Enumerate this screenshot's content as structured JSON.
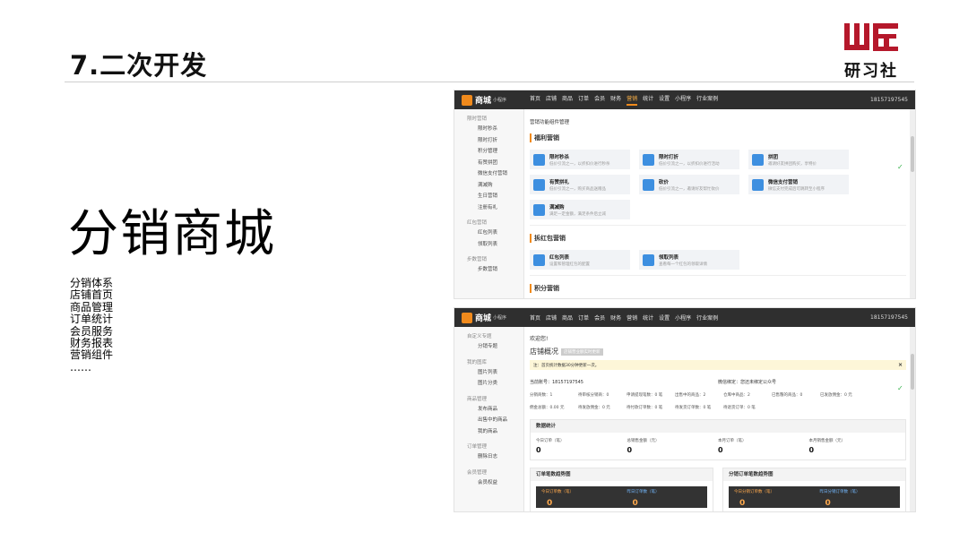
{
  "slide": {
    "title": "7.二次开发",
    "heading": "分销商城",
    "features": [
      "分销体系",
      "店铺首页",
      "商品管理",
      "订单统计",
      "会员服务",
      "财务报表",
      "营销组件",
      "……"
    ]
  },
  "logo": {
    "mark_text": "山丘",
    "text": "研习社",
    "color": "#b5182b"
  },
  "app": {
    "brand": "商城",
    "brand_sub": "小程序",
    "nav": [
      "首页",
      "店铺",
      "商品",
      "订单",
      "会员",
      "财务",
      "营销",
      "统计",
      "设置",
      "小程序",
      "行业案例"
    ],
    "phone": "18157197545"
  },
  "shot1": {
    "sidebar": [
      {
        "head": "限时营销",
        "items": [
          "限时秒杀",
          "限时打折",
          "积分管理",
          "有赞拼团",
          "微信支付营销",
          "满减购",
          "生日营销",
          "注册有礼"
        ]
      },
      {
        "head": "红包营销",
        "items": [
          "红包列表",
          "领取列表"
        ]
      },
      {
        "head": "步数营销",
        "items": [
          "步数营销"
        ]
      }
    ],
    "breadcrumb": "营销功能组件管理",
    "sections": [
      {
        "title": "福利营销",
        "cards": [
          {
            "t": "限时秒杀",
            "d": "低价引流之一，以折扣价进行秒杀"
          },
          {
            "t": "限时打折",
            "d": "低价引流之一，以折扣价进行活动"
          },
          {
            "t": "拼团",
            "d": "邀请好友拼团购买，享特价"
          },
          {
            "t": "有赞拼礼",
            "d": "低价引流之一，购买商品送赠品"
          },
          {
            "t": "砍价",
            "d": "低价引流之一，邀请好友帮忙砍价"
          },
          {
            "t": "微信支付营销",
            "d": "微信支付完成后可跳转至小程序"
          },
          {
            "t": "满减购",
            "d": "满足一定金额，满足条件后立减"
          }
        ]
      },
      {
        "title": "拆红包营销",
        "cards": [
          {
            "t": "红包列表",
            "d": "设置和管理红包的配置"
          },
          {
            "t": "领取列表",
            "d": "查看每一个红包的领取详情"
          }
        ]
      },
      {
        "title": "积分营销",
        "cards": []
      }
    ]
  },
  "shot2": {
    "sidebar": [
      {
        "head": "自定义专题",
        "items": [
          "分销专题"
        ]
      },
      {
        "head": "我的图库",
        "items": [
          "图片列表",
          "图片分类"
        ]
      },
      {
        "head": "商品管理",
        "items": [
          "发布商品",
          "出售中的商品",
          "我的商品"
        ]
      },
      {
        "head": "订单管理",
        "items": [
          "删除日志"
        ]
      },
      {
        "head": "会员管理",
        "items": [
          "会员权益"
        ]
      }
    ],
    "welcome": "欢迎您!",
    "overview": "店铺概况",
    "overview_tag": "店铺营业额实时更新",
    "notice": "注：首页统计数据30分钟更新一次。",
    "account_label": "当前账号：18157197545",
    "wechat_label": "微信绑定：您还未绑定公众号",
    "stats": [
      "分销商数：1",
      "待审核分销商：0",
      "申请提现笔数：0 笔",
      "出售中的商品：2",
      "仓库中商品：2",
      "已售罄的商品：0",
      "已发放佣金：0 元",
      "佣金总额：0.00 元",
      "待发放佣金：0 元",
      "待付款订单数：0 笔",
      "待发货订单数：0 笔",
      "待退货订单：0 笔"
    ],
    "data_title": "数据统计",
    "data_cells": [
      {
        "label": "今日订单（笔）",
        "value": "0"
      },
      {
        "label": "总销售金额（元）",
        "value": "0"
      },
      {
        "label": "本月订单（笔）",
        "value": "0"
      },
      {
        "label": "本月销售金额（元）",
        "value": "0"
      }
    ],
    "panel_left": "订单笔数趋势图",
    "panel_right": "分销订单笔数趋势图",
    "dark_left": [
      {
        "label": "今日订单数（笔）",
        "value": "0"
      },
      {
        "label": "昨日订单数（笔）",
        "value": "0"
      }
    ],
    "dark_right": [
      {
        "label": "今日分销订单数（笔）",
        "value": "0"
      },
      {
        "label": "昨日分销订单数（笔）",
        "value": "0"
      }
    ]
  }
}
